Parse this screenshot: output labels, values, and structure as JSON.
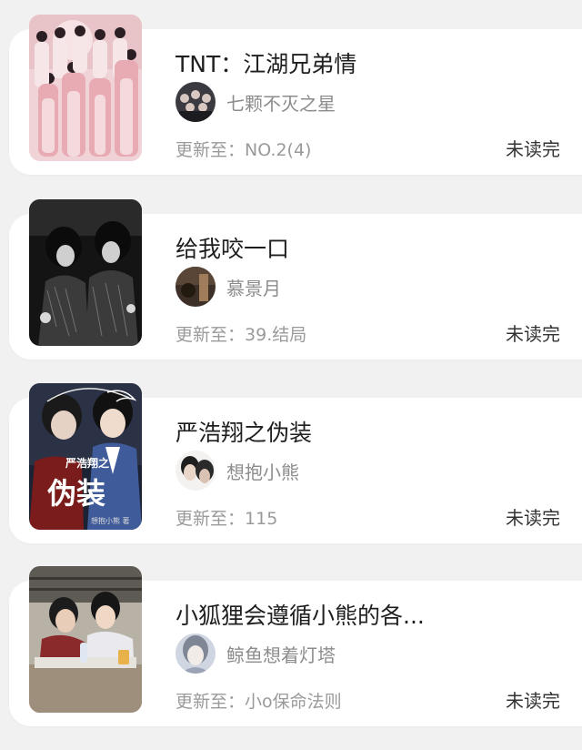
{
  "update_prefix": "更新至：",
  "books": [
    {
      "title": "TNT：江湖兄弟情",
      "author": "七颗不灭之星",
      "latest_chapter": "NO.2(4)",
      "status": "未读完",
      "cover_icon": "group-photo-cover",
      "avatar_icon": "group-avatar"
    },
    {
      "title": "给我咬一口",
      "author": "慕景月",
      "latest_chapter": "39.结局",
      "status": "未读完",
      "cover_icon": "dark-performance-cover",
      "avatar_icon": "dim-room-avatar"
    },
    {
      "title": "严浩翔之伪装",
      "author": "想抱小熊",
      "latest_chapter": "115",
      "status": "未读完",
      "cover_icon": "novel-cover",
      "avatar_icon": "dark-portrait-avatar"
    },
    {
      "title": "小狐狸会遵循小熊的各...",
      "author": "鲸鱼想着灯塔",
      "latest_chapter": "小o保命法则",
      "status": "未读完",
      "cover_icon": "classroom-photo-cover",
      "avatar_icon": "light-portrait-avatar"
    }
  ],
  "cover_texts": {
    "book3_title_top": "严浩翔之",
    "book3_title_main": "伪装",
    "book3_byline": "想抱小熊 著"
  }
}
